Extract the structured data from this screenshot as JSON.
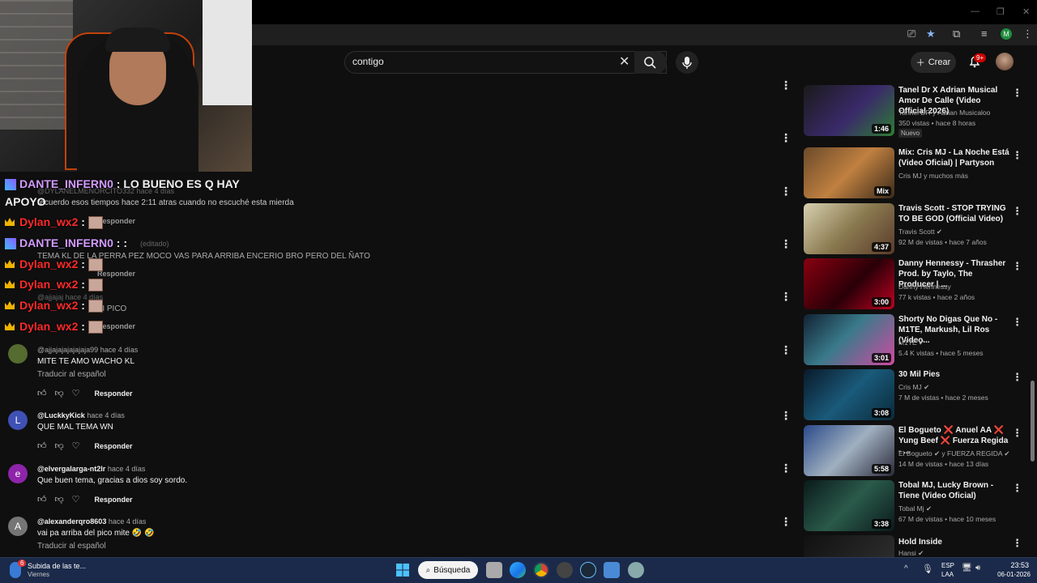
{
  "search": {
    "value": "contigo"
  },
  "header": {
    "create_label": "Crear",
    "notif_count": "9+"
  },
  "chat": [
    {
      "user": "DANTE_INFERN0",
      "msg": ": LO BUENO ES Q HAY",
      "cont": "APOYO"
    },
    {
      "user": "Dylan_wx2",
      "msg": ":"
    },
    {
      "user": "DANTE_INFERN0",
      "msg": ": :"
    },
    {
      "user": "Dylan_wx2",
      "msg": ":"
    },
    {
      "user": "Dylan_wx2",
      "msg": ":"
    },
    {
      "user": "Dylan_wx2",
      "msg": ":"
    },
    {
      "user": "Dylan_wx2",
      "msg": ":"
    }
  ],
  "comments_partial": {
    "c1_author": "@DYLANELMENORCITO332 hace 4 días",
    "c1_text": "recuerdo esos tiempos hace 2:11 atras cuando no escuché esta mierda",
    "c2_meta": "(editado)",
    "c2_text": "TEMA KL DE LA PERRA PEZ MOCO VAS PARA ARRIBA ENCERIO BRO PERO DEL ÑATO",
    "c3_author": "@ajjajaj hace 4 días",
    "c3_text": "MI PICO",
    "reply": "Responder"
  },
  "comments": [
    {
      "author": "@ajjajajajajajaja99",
      "time": "hace 4 días",
      "text": "MITE TE AMO WACHO KL",
      "translate": "Traducir al español",
      "reply": "Responder",
      "avatar": "",
      "color": "#556b2f"
    },
    {
      "author": "@LuckkyKick",
      "time": "hace 4 días",
      "text": "QUE MAL TEMA WN",
      "translate": "",
      "reply": "Responder",
      "avatar": "L",
      "color": "#3f51b5"
    },
    {
      "author": "@elvergalarga-nt2lr",
      "time": "hace 4 días",
      "text": "Que buen tema, gracias a dios soy sordo.",
      "translate": "",
      "reply": "Responder",
      "avatar": "e",
      "color": "#8e24aa"
    },
    {
      "author": "@alexanderqro8603",
      "time": "hace 4 días",
      "text": "vai pa arriba del pico mite 🤣 🤣",
      "translate": "Traducir al español",
      "reply": "",
      "avatar": "A",
      "color": "#757575"
    }
  ],
  "recommendations": [
    {
      "title": "Tanel Dr X Adrian Musical Amor De Calle (Video Official 2026)",
      "channel": "Tannel DR y Adrian Musicaloo",
      "meta": "350 vistas • hace 8 horas",
      "duration": "1:46",
      "badge": "Nuevo",
      "thumb": "linear-gradient(135deg,#1a1a1a,#3a2a6a 55%,#2e7d32)"
    },
    {
      "title": "Mix: Cris MJ - La Noche Está (Video Oficial) | Partyson",
      "channel": "Cris MJ y muchos más",
      "meta": "",
      "duration": "Mix",
      "badge": "",
      "thumb": "linear-gradient(135deg,#6b4a2a,#c08040 50%,#3a2a1a)"
    },
    {
      "title": "Travis Scott - STOP TRYING TO BE GOD (Official Video)",
      "channel": "Travis Scott ✔",
      "meta": "92 M de vistas • hace 7 años",
      "duration": "4:37",
      "badge": "",
      "thumb": "linear-gradient(135deg,#d8d0b0,#8a7a50 50%,#5a3a2a)"
    },
    {
      "title": "Danny Hennessy - Thrasher Prod. by Taylo, The Producer | ...",
      "channel": "Danny Hennessy",
      "meta": "77 k vistas • hace 2 años",
      "duration": "3:00",
      "badge": "",
      "thumb": "linear-gradient(135deg,#8a0010,#2a0008 55%,#c00020)"
    },
    {
      "title": "Shorty No Digas Que No - M1TE, Markush, Lil Ros (Video...",
      "channel": "M1TE ✔",
      "meta": "5.4 K vistas • hace 5 meses",
      "duration": "3:01",
      "badge": "",
      "thumb": "linear-gradient(135deg,#123,#3a7a8a 45%,#d04aa0)"
    },
    {
      "title": "30 Mil Pies",
      "channel": "Cris MJ ✔",
      "meta": "7 M de vistas • hace 2 meses",
      "duration": "3:08",
      "badge": "",
      "thumb": "linear-gradient(135deg,#0a1a2a,#1a5a7a 50%,#0a2a3a)"
    },
    {
      "title": "El Bogueto ❌ Anuel AA ❌ Yung Beef ❌ Fuerza Regida - ...",
      "channel": "El Bogueto ✔ y FUERZA REGIDA ✔",
      "meta": "14 M de vistas • hace 13 días",
      "duration": "5:58",
      "badge": "",
      "thumb": "linear-gradient(135deg,#2a4a8a,#a0b0c0 50%,#2a2a3a)"
    },
    {
      "title": "Tobal MJ, Lucky Brown - Tiene (Video Oficial)",
      "channel": "Tobal Mj ✔",
      "meta": "67 M de vistas • hace 10 meses",
      "duration": "3:38",
      "badge": "",
      "thumb": "linear-gradient(135deg,#0a1a1a,#2a5a4a 50%,#0a1a1a)"
    },
    {
      "title": "Hold Inside",
      "channel": "Hansi ✔",
      "meta": "",
      "duration": "",
      "badge": "",
      "thumb": "linear-gradient(135deg,#111,#333)"
    }
  ],
  "taskbar": {
    "weather_temp": "6",
    "weather_title": "Subida de las te...",
    "weather_sub": "Viernes",
    "search_label": "Búsqueda",
    "lang": "ESP",
    "lang2": "LAA",
    "time": "23:53",
    "date": "06-01-2026"
  }
}
